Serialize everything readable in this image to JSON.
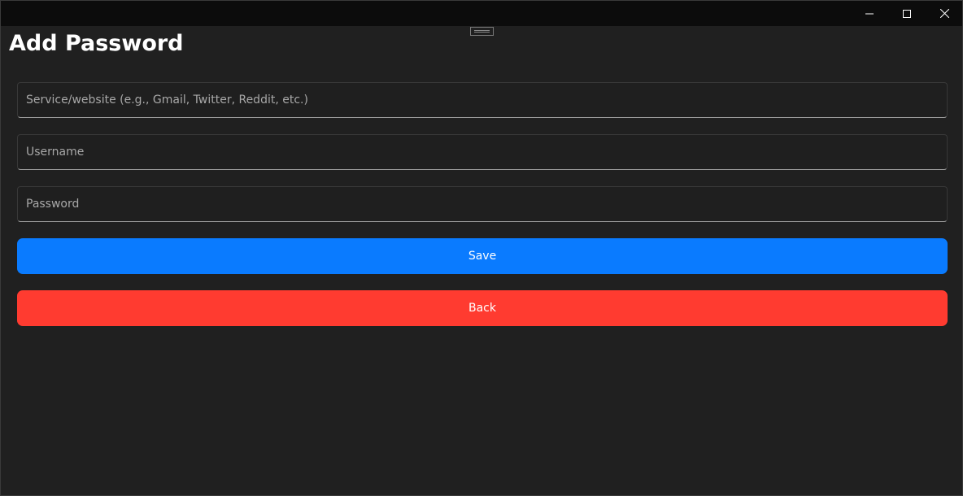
{
  "window": {
    "caption_buttons": [
      "minimize-icon",
      "maximize-icon",
      "close-icon"
    ]
  },
  "page": {
    "title": "Add Password"
  },
  "form": {
    "service_placeholder": "Service/website (e.g., Gmail, Twitter, Reddit, etc.)",
    "username_placeholder": "Username",
    "password_placeholder": "Password",
    "service_value": "",
    "username_value": "",
    "password_value": ""
  },
  "actions": {
    "save_label": "Save",
    "back_label": "Back"
  },
  "colors": {
    "background": "#202020",
    "titlebar": "#0c0c0c",
    "save": "#0a7bff",
    "back": "#ff3b30"
  }
}
